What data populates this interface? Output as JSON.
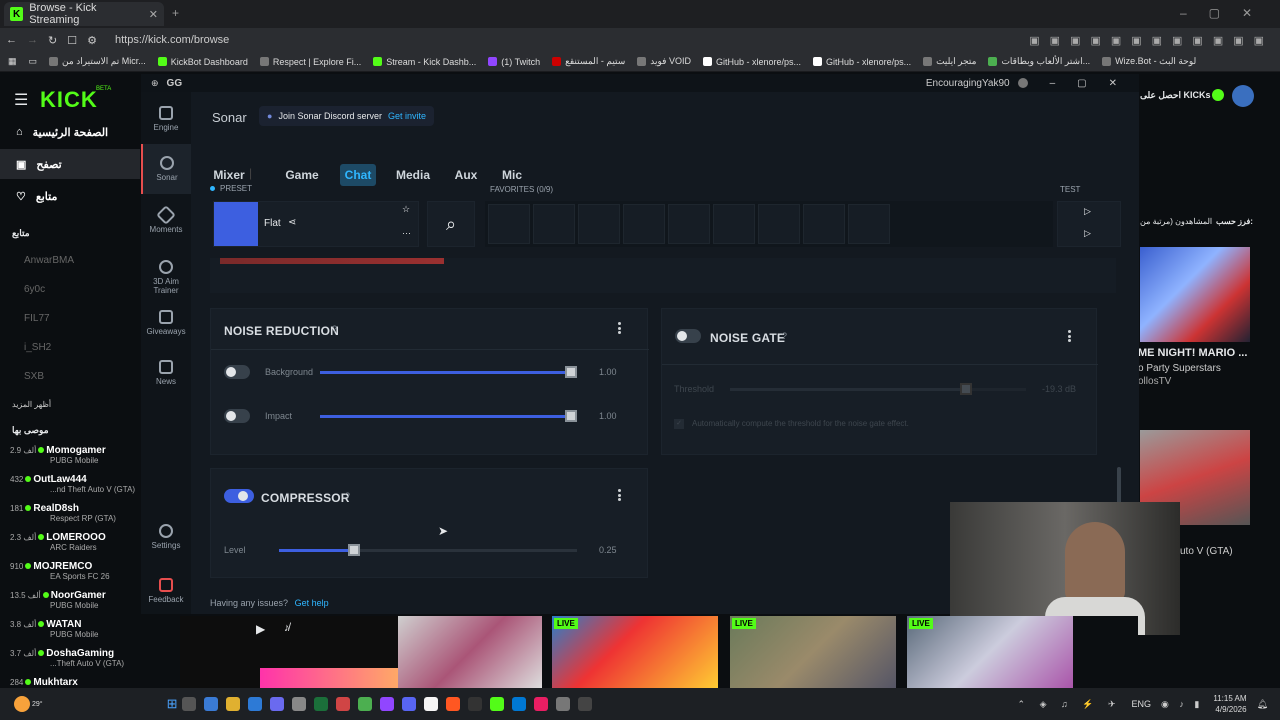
{
  "browser": {
    "tab_title": "Browse - Kick Streaming",
    "new_tab": "+",
    "url": "https://kick.com/browse",
    "bookmarks": [
      "تم الاستيراد من Micr...",
      "KickBot Dashboard",
      "Respect | Explore Fi...",
      "Stream - Kick Dashb...",
      "(1) Twitch",
      "ستيم - المستنقع",
      "فويد VOID",
      "GitHub - xlenore/ps...",
      "GitHub - xlenore/ps...",
      "متجر ايليت",
      "اشتر الألعاب وبطاقات...",
      "Wize.Bot - لوحة البث"
    ]
  },
  "kick": {
    "logo": "KICK",
    "beta": "BETA",
    "nav": [
      "الصفحة الرئيسية",
      "تصفح",
      "متابع"
    ],
    "following_header": "متابع",
    "following": [
      "AnwarBMA",
      "6y0c",
      "FIL77",
      "i_SH2",
      "SXB"
    ],
    "show_more": "أظهر المزيد",
    "recommended_header": "موصى بها",
    "recommended": [
      {
        "count": "2.9 ألف",
        "name": "Momogamer",
        "game": "PUBG Mobile"
      },
      {
        "count": "432",
        "name": "OutLaw444",
        "game": "...nd Theft Auto V (GTA)"
      },
      {
        "count": "181",
        "name": "RealD8sh",
        "game": "Respect RP (GTA)"
      },
      {
        "count": "2.3 ألف",
        "name": "LOMEROOO",
        "game": "ARC Raiders"
      },
      {
        "count": "910",
        "name": "MOJREMCO",
        "game": "EA Sports FC 26"
      },
      {
        "count": "13.5 ألف",
        "name": "NoorGamer",
        "game": "PUBG Mobile"
      },
      {
        "count": "3.8 ألف",
        "name": "WATAN",
        "game": "PUBG Mobile"
      },
      {
        "count": "3.7 ألف",
        "name": "DoshaGaming",
        "game": "...Theft Auto V (GTA)"
      },
      {
        "count": "284",
        "name": "Mukhtarx",
        "game": ""
      }
    ],
    "header_right": "احصل على KICKs",
    "sort_label": "فرز حسب:",
    "sort_value": "المشاهدون (مرتبة من",
    "card1_title": "ME NIGHT! MARIO ...",
    "card1_sub": "o Party Superstars",
    "card1_user": "ollosTV",
    "card2_sub": "uto V (GTA)"
  },
  "gg": {
    "logo": "GG",
    "user": "EncouragingYak90",
    "nav": [
      "Engine",
      "Sonar",
      "Moments",
      "3D Aim Trainer",
      "Giveaways",
      "News",
      "Settings",
      "Feedback"
    ],
    "app_name": "Sonar",
    "discord_text": "Join Sonar Discord server",
    "discord_link": "Get invite",
    "tabs": [
      "Mixer",
      "Game",
      "Chat",
      "Media",
      "Aux",
      "Mic"
    ],
    "preset_label": "PRESET",
    "preset_name": "Flat",
    "favorites_label": "FAVORITES (0/9)",
    "test_label": "TEST",
    "noise_reduction": {
      "title": "NOISE REDUCTION",
      "help": "?",
      "background_label": "Background",
      "background_value": "1.00",
      "background_fraction": 1.0,
      "impact_label": "Impact",
      "impact_value": "1.00",
      "impact_fraction": 1.0
    },
    "noise_gate": {
      "title": "NOISE GATE",
      "help": "?",
      "threshold_label": "Threshold",
      "threshold_value": "-19.3 dB",
      "auto_text": "Automatically compute the threshold for the noise gate effect."
    },
    "compressor": {
      "title": "COMPRESSOR",
      "help": "?",
      "level_label": "Level",
      "level_value": "0.25",
      "level_fraction": 0.25
    },
    "help_text": "Having any issues?",
    "help_link": "Get help"
  },
  "taskbar": {
    "temp": "29°",
    "lang": "ENG",
    "time": "11:15 AM",
    "date": "4/9/2026"
  },
  "strip": {
    "live": "LIVE"
  },
  "colors": {
    "kick_green": "#53fc18",
    "accent": "#3d5fe0",
    "chat_tab": "#2fb6ff",
    "feedback": "#e64e4e"
  }
}
